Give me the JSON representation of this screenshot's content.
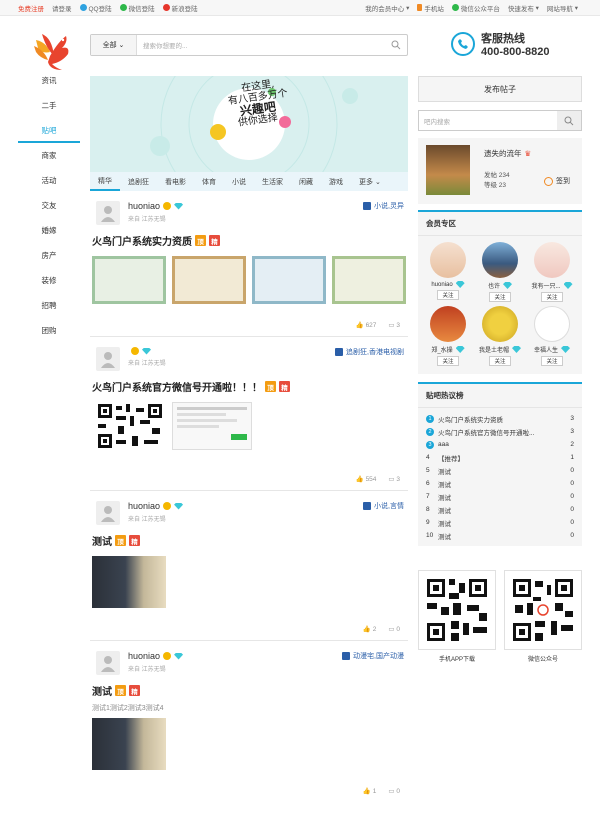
{
  "topbar": {
    "register": "免费注册",
    "login": "请登录",
    "qq": "QQ登陆",
    "wechat": "微信登陆",
    "weibo": "新浪登陆",
    "member_center": "我的会员中心",
    "mobile": "手机站",
    "wx_public": "微信公众平台",
    "quick_publish": "快速发布",
    "site_nav": "网站导航"
  },
  "search": {
    "category": "全部",
    "placeholder": "搜索你想要的..."
  },
  "hotline": {
    "title": "客服热线",
    "number": "400-800-8820"
  },
  "leftnav": [
    "资讯",
    "二手",
    "贴吧",
    "商家",
    "活动",
    "交友",
    "婚嫁",
    "房产",
    "装修",
    "招聘",
    "团购"
  ],
  "banner": {
    "line1": "在这里,",
    "line2": "有八百多万个",
    "line3": "兴趣吧",
    "line4": "供你选择"
  },
  "tabs": [
    "精华",
    "追剧狂",
    "看电影",
    "体育",
    "小说",
    "生活家",
    "闲藏",
    "游戏",
    "更多"
  ],
  "posts": [
    {
      "user": "huoniao",
      "from": "来自 江苏无锡",
      "tag": "小说,灵异",
      "title": "火鸟门户系统实力资质",
      "b1": "顶",
      "b2": "精",
      "likes": "627",
      "comments": "3",
      "text": ""
    },
    {
      "user": "",
      "from": "来自 江苏无锡",
      "tag": "追剧狂,香港电视剧",
      "title": "火鸟门户系统官方微信号开通啦！！！",
      "b1": "顶",
      "b2": "精",
      "likes": "554",
      "comments": "3",
      "text": ""
    },
    {
      "user": "huoniao",
      "from": "来自 江苏无锡",
      "tag": "小说,言情",
      "title": "测试",
      "b1": "顶",
      "b2": "精",
      "likes": "2",
      "comments": "0",
      "text": ""
    },
    {
      "user": "huoniao",
      "from": "来自 江苏无锡",
      "tag": "动漫宅,国产动漫",
      "title": "测试",
      "b1": "顶",
      "b2": "精",
      "likes": "1",
      "comments": "0",
      "text": "测试1测试2测试3测试4"
    }
  ],
  "side": {
    "post_btn": "发布帖子",
    "search_ph": "吧内搜索",
    "user": {
      "name": "遗失的流年",
      "posts": "发帖 234",
      "level": "等级 23",
      "signin": "签到"
    },
    "members_title": "会员专区",
    "members": [
      {
        "name": "huoniao"
      },
      {
        "name": "也许"
      },
      {
        "name": "我有一只..."
      },
      {
        "name": "郑_水操"
      },
      {
        "name": "我是土老帽"
      },
      {
        "name": "幸福人生"
      }
    ],
    "follow": "关注",
    "rank_title": "贴吧热议榜",
    "rank": [
      {
        "n": "1",
        "t": "火鸟门户系统实力资质",
        "c": "3"
      },
      {
        "n": "2",
        "t": "火鸟门户系统官方微信号开通啦...",
        "c": "3"
      },
      {
        "n": "3",
        "t": "aaa",
        "c": "2"
      },
      {
        "n": "4",
        "t": "【推荐】",
        "c": "1"
      },
      {
        "n": "5",
        "t": "测试",
        "c": "0"
      },
      {
        "n": "6",
        "t": "测试",
        "c": "0"
      },
      {
        "n": "7",
        "t": "测试",
        "c": "0"
      },
      {
        "n": "8",
        "t": "测试",
        "c": "0"
      },
      {
        "n": "9",
        "t": "测试",
        "c": "0"
      },
      {
        "n": "10",
        "t": "测试",
        "c": "0"
      }
    ],
    "qr1": "手机APP下载",
    "qr2": "微信公众号"
  }
}
